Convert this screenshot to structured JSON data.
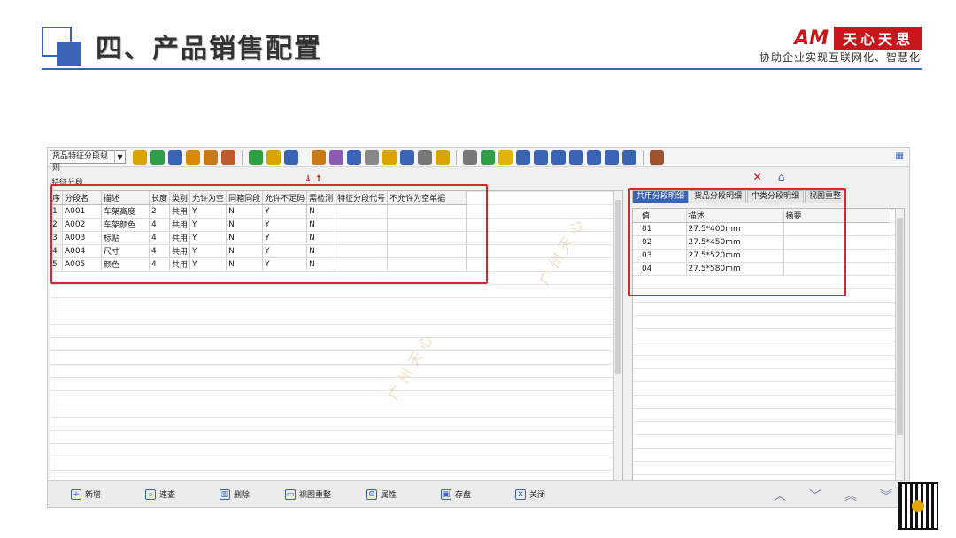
{
  "slide": {
    "title": "四、产品销售配置",
    "brand_logo": "AM",
    "brand_name": "天心天思",
    "slogan": "协助企业实现互联网化、智慧化"
  },
  "toolbar": {
    "rule_select": "货品特征分段规则",
    "icons": [
      "abc-icon",
      "phone-icon",
      "computer-icon",
      "lock-icon",
      "briefcase-icon",
      "home-icon",
      "dollar-icon",
      "money-bag-icon",
      "cart-icon",
      "clipboard-icon",
      "people-icon",
      "edit-icon",
      "help-icon",
      "mail-icon",
      "info-icon",
      "document-icon",
      "folder-icon",
      "copy-icon",
      "check-icon",
      "bell-icon",
      "search-icon",
      "org-chart-icon",
      "monitor-icon",
      "refresh-icon",
      "window-icon",
      "close-box-icon",
      "image-icon",
      "book-icon"
    ],
    "corner_icon": "layout-icon"
  },
  "left": {
    "label": "特征分段",
    "columns": [
      "序",
      "分段名",
      "描述",
      "长度",
      "类别",
      "允许为空",
      "同箱同段",
      "允许不足码",
      "需检测",
      "特征分段代号",
      "不允许为空单据"
    ],
    "rows": [
      [
        "1",
        "A001",
        "车架高度",
        "2",
        "共用",
        "Y",
        "N",
        "Y",
        "N",
        "",
        ""
      ],
      [
        "2",
        "A002",
        "车架颜色",
        "4",
        "共用",
        "Y",
        "N",
        "Y",
        "N",
        "",
        ""
      ],
      [
        "3",
        "A003",
        "标贴",
        "4",
        "共用",
        "Y",
        "N",
        "Y",
        "N",
        "",
        ""
      ],
      [
        "4",
        "A004",
        "尺寸",
        "4",
        "共用",
        "Y",
        "N",
        "Y",
        "N",
        "",
        ""
      ],
      [
        "5",
        "A005",
        "颜色",
        "4",
        "共用",
        "Y",
        "N",
        "Y",
        "N",
        "",
        ""
      ]
    ]
  },
  "right": {
    "tabs": [
      "共用分段明细",
      "货品分段明细",
      "中类分段明细",
      "视图重整"
    ],
    "active_tab": 0,
    "columns": [
      "值",
      "描述",
      "摘要"
    ],
    "rows": [
      [
        "01",
        "27.5*400mm",
        ""
      ],
      [
        "02",
        "27.5*450mm",
        ""
      ],
      [
        "03",
        "27.5*520mm",
        ""
      ],
      [
        "04",
        "27.5*580mm",
        ""
      ]
    ]
  },
  "bottom": {
    "buttons": [
      "新增",
      "速查",
      "删除",
      "视图重整",
      "属性",
      "存盘",
      "关闭"
    ]
  },
  "colors": {
    "accent": "#3a63b5",
    "annotation": "#d8262c",
    "brand": "#c8161d"
  }
}
